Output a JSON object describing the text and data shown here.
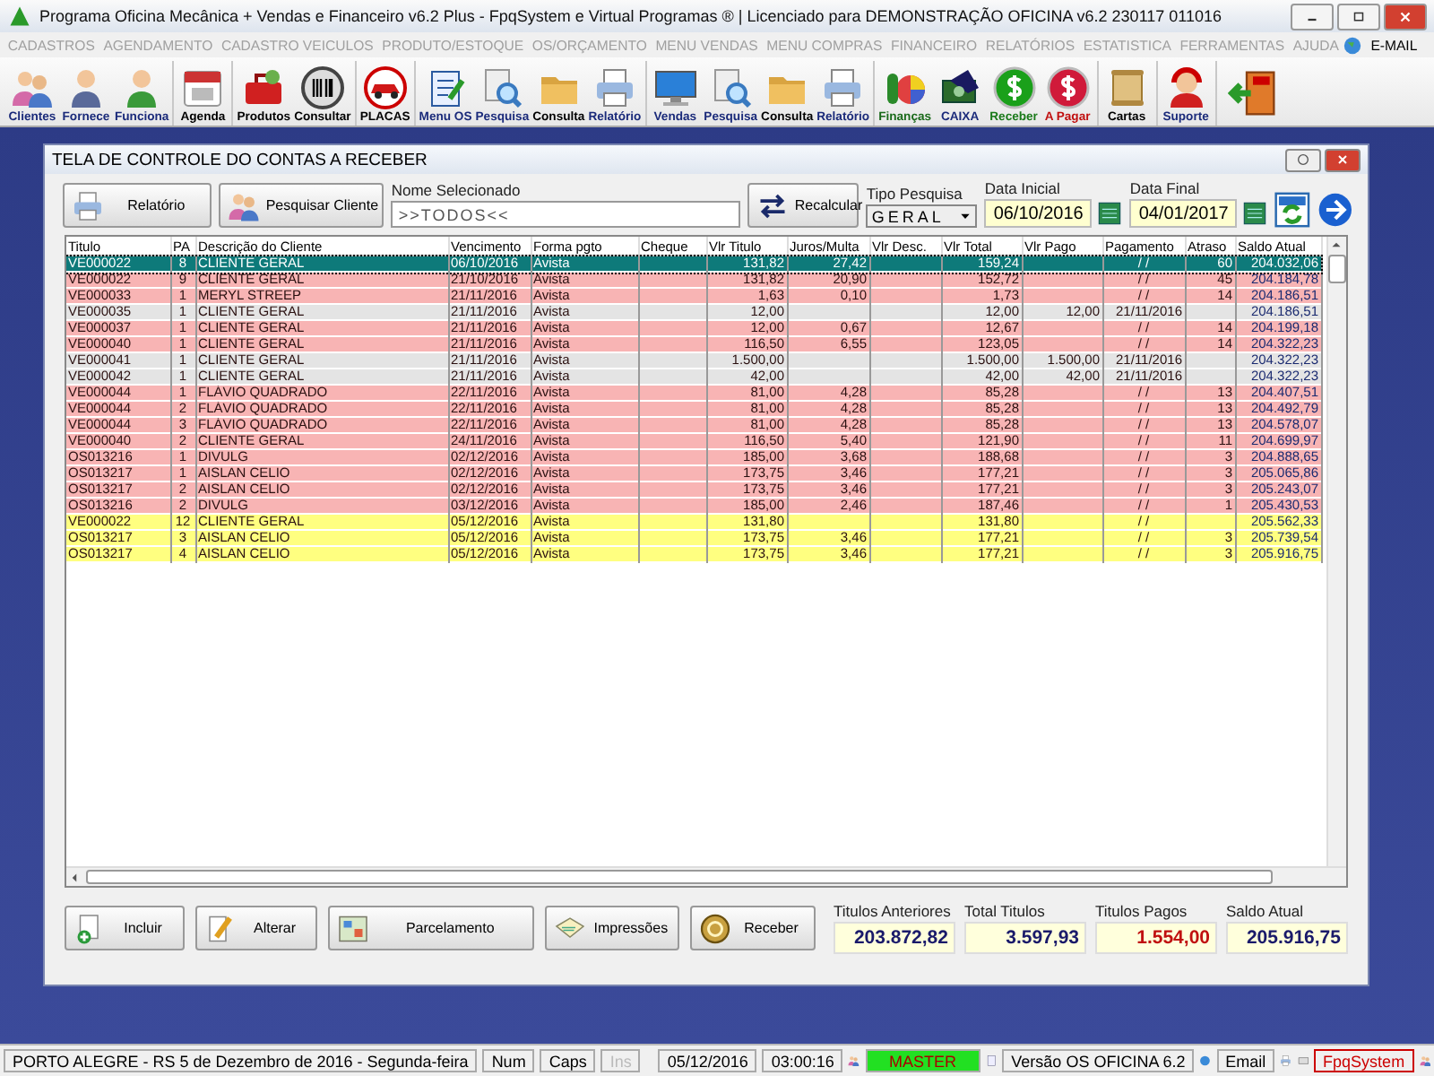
{
  "window": {
    "title": "Programa Oficina Mecânica + Vendas e Financeiro v6.2 Plus - FpqSystem e Virtual Programas ® | Licenciado para  DEMONSTRAÇÃO OFICINA v6.2 230117 011016"
  },
  "menu": [
    "CADASTROS",
    "AGENDAMENTO",
    "CADASTRO VEICULOS",
    "PRODUTO/ESTOQUE",
    "OS/ORÇAMENTO",
    "MENU VENDAS",
    "MENU COMPRAS",
    "FINANCEIRO",
    "RELATÓRIOS",
    "ESTATISTICA",
    "FERRAMENTAS",
    "AJUDA"
  ],
  "menu_email": "E-MAIL",
  "toolbar": [
    [
      {
        "label": "Clientes",
        "color": "#1a2a7a"
      },
      {
        "label": "Fornece",
        "color": "#1a2a7a"
      },
      {
        "label": "Funciona",
        "color": "#1a2a7a"
      }
    ],
    [
      {
        "label": "Agenda",
        "color": "#000000"
      }
    ],
    [
      {
        "label": "Produtos",
        "color": "#000000"
      },
      {
        "label": "Consultar",
        "color": "#000000"
      }
    ],
    [
      {
        "label": "PLACAS",
        "color": "#000000"
      }
    ],
    [
      {
        "label": "Menu OS",
        "color": "#1a2a7a"
      },
      {
        "label": "Pesquisa",
        "color": "#1a2a7a"
      },
      {
        "label": "Consulta",
        "color": "#000000"
      },
      {
        "label": "Relatório",
        "color": "#1a2a7a"
      }
    ],
    [
      {
        "label": "Vendas",
        "color": "#1a2a7a"
      },
      {
        "label": "Pesquisa",
        "color": "#1a2a7a"
      },
      {
        "label": "Consulta",
        "color": "#000000"
      },
      {
        "label": "Relatório",
        "color": "#1a2a7a"
      }
    ],
    [
      {
        "label": "Finanças",
        "color": "#1a6a1a"
      },
      {
        "label": "CAIXA",
        "color": "#1a2a7a"
      },
      {
        "label": "Receber",
        "color": "#1a7a1a"
      },
      {
        "label": "A Pagar",
        "color": "#c01010"
      }
    ],
    [
      {
        "label": "Cartas",
        "color": "#000000"
      }
    ],
    [
      {
        "label": "Suporte",
        "color": "#1a2a7a"
      }
    ]
  ],
  "dialog": {
    "title": "TELA DE CONTROLE DO CONTAS A RECEBER",
    "report_button": "Relatório",
    "search_client_button": "Pesquisar Cliente",
    "name_field": {
      "label": "Nome Selecionado",
      "value": ">>TODOS<<"
    },
    "recalc_button": "Recalcular",
    "search_type": {
      "label": "Tipo  Pesquisa",
      "value": "GERAL"
    },
    "start_date": {
      "label": "Data Inicial",
      "value": "06/10/2016"
    },
    "end_date": {
      "label": "Data Final",
      "value": "04/01/2017"
    },
    "table": {
      "columns": [
        "Titulo",
        "PA",
        "Descrição do Cliente",
        "Vencimento",
        "Forma pgto",
        "Cheque",
        "Vlr Titulo",
        "Juros/Multa",
        "Vlr Desc.",
        "Vlr Total",
        "Vlr Pago",
        "Pagamento",
        "Atraso",
        "Saldo Atual"
      ],
      "rows": [
        {
          "selected": true,
          "color": "#0e7a7a",
          "titulo": "VE000022",
          "pa": "8",
          "cliente": "CLIENTE GERAL",
          "vencimento": "06/10/2016",
          "forma": "Avista",
          "vlr_titulo": "131,82",
          "juros": "27,42",
          "vlr_total": "159,24",
          "pagamento": "/ /",
          "atraso": "60",
          "saldo": "204.032,06"
        },
        {
          "selected": false,
          "color": "#f8b4b4",
          "titulo": "VE000022",
          "pa": "9",
          "cliente": "CLIENTE GERAL",
          "vencimento": "21/10/2016",
          "forma": "Avista",
          "vlr_titulo": "131,82",
          "juros": "20,90",
          "vlr_total": "152,72",
          "pagamento": "/ /",
          "atraso": "45",
          "saldo": "204.184,78"
        },
        {
          "selected": false,
          "color": "#f8b4b4",
          "titulo": "VE000033",
          "pa": "1",
          "cliente": "MERYL STREEP",
          "vencimento": "21/11/2016",
          "forma": "Avista",
          "vlr_titulo": "1,63",
          "juros": "0,10",
          "vlr_total": "1,73",
          "pagamento": "/ /",
          "atraso": "14",
          "saldo": "204.186,51"
        },
        {
          "selected": false,
          "color": "#e4e4e4",
          "titulo": "VE000035",
          "pa": "1",
          "cliente": "CLIENTE GERAL",
          "vencimento": "21/11/2016",
          "forma": "Avista",
          "vlr_titulo": "12,00",
          "vlr_total": "12,00",
          "vlr_pago": "12,00",
          "pagamento": "21/11/2016",
          "saldo": "204.186,51"
        },
        {
          "selected": false,
          "color": "#f8b4b4",
          "titulo": "VE000037",
          "pa": "1",
          "cliente": "CLIENTE GERAL",
          "vencimento": "21/11/2016",
          "forma": "Avista",
          "vlr_titulo": "12,00",
          "juros": "0,67",
          "vlr_total": "12,67",
          "pagamento": "/ /",
          "atraso": "14",
          "saldo": "204.199,18"
        },
        {
          "selected": false,
          "color": "#f8b4b4",
          "titulo": "VE000040",
          "pa": "1",
          "cliente": "CLIENTE GERAL",
          "vencimento": "21/11/2016",
          "forma": "Avista",
          "vlr_titulo": "116,50",
          "juros": "6,55",
          "vlr_total": "123,05",
          "pagamento": "/ /",
          "atraso": "14",
          "saldo": "204.322,23"
        },
        {
          "selected": false,
          "color": "#e4e4e4",
          "titulo": "VE000041",
          "pa": "1",
          "cliente": "CLIENTE GERAL",
          "vencimento": "21/11/2016",
          "forma": "Avista",
          "vlr_titulo": "1.500,00",
          "vlr_total": "1.500,00",
          "vlr_pago": "1.500,00",
          "pagamento": "21/11/2016",
          "saldo": "204.322,23"
        },
        {
          "selected": false,
          "color": "#e4e4e4",
          "titulo": "VE000042",
          "pa": "1",
          "cliente": "CLIENTE GERAL",
          "vencimento": "21/11/2016",
          "forma": "Avista",
          "vlr_titulo": "42,00",
          "vlr_total": "42,00",
          "vlr_pago": "42,00",
          "pagamento": "21/11/2016",
          "saldo": "204.322,23"
        },
        {
          "selected": false,
          "color": "#f8b4b4",
          "titulo": "VE000044",
          "pa": "1",
          "cliente": "FLÁVIO QUADRADO",
          "vencimento": "22/11/2016",
          "forma": "Avista",
          "vlr_titulo": "81,00",
          "juros": "4,28",
          "vlr_total": "85,28",
          "pagamento": "/ /",
          "atraso": "13",
          "saldo": "204.407,51"
        },
        {
          "selected": false,
          "color": "#f8b4b4",
          "titulo": "VE000044",
          "pa": "2",
          "cliente": "FLÁVIO QUADRADO",
          "vencimento": "22/11/2016",
          "forma": "Avista",
          "vlr_titulo": "81,00",
          "juros": "4,28",
          "vlr_total": "85,28",
          "pagamento": "/ /",
          "atraso": "13",
          "saldo": "204.492,79"
        },
        {
          "selected": false,
          "color": "#f8b4b4",
          "titulo": "VE000044",
          "pa": "3",
          "cliente": "FLÁVIO QUADRADO",
          "vencimento": "22/11/2016",
          "forma": "Avista",
          "vlr_titulo": "81,00",
          "juros": "4,28",
          "vlr_total": "85,28",
          "pagamento": "/ /",
          "atraso": "13",
          "saldo": "204.578,07"
        },
        {
          "selected": false,
          "color": "#f8b4b4",
          "titulo": "VE000040",
          "pa": "2",
          "cliente": "CLIENTE GERAL",
          "vencimento": "24/11/2016",
          "forma": "Avista",
          "vlr_titulo": "116,50",
          "juros": "5,40",
          "vlr_total": "121,90",
          "pagamento": "/ /",
          "atraso": "11",
          "saldo": "204.699,97"
        },
        {
          "selected": false,
          "color": "#f8b4b4",
          "titulo": "OS013216",
          "pa": "1",
          "cliente": "DIVULG",
          "vencimento": "02/12/2016",
          "forma": "Avista",
          "vlr_titulo": "185,00",
          "juros": "3,68",
          "vlr_total": "188,68",
          "pagamento": "/ /",
          "atraso": "3",
          "saldo": "204.888,65"
        },
        {
          "selected": false,
          "color": "#f8b4b4",
          "titulo": "OS013217",
          "pa": "1",
          "cliente": "AISLAN CELIO",
          "vencimento": "02/12/2016",
          "forma": "Avista",
          "vlr_titulo": "173,75",
          "juros": "3,46",
          "vlr_total": "177,21",
          "pagamento": "/ /",
          "atraso": "3",
          "saldo": "205.065,86"
        },
        {
          "selected": false,
          "color": "#f8b4b4",
          "titulo": "OS013217",
          "pa": "2",
          "cliente": "AISLAN CELIO",
          "vencimento": "02/12/2016",
          "forma": "Avista",
          "vlr_titulo": "173,75",
          "juros": "3,46",
          "vlr_total": "177,21",
          "pagamento": "/ /",
          "atraso": "3",
          "saldo": "205.243,07"
        },
        {
          "selected": false,
          "color": "#f8b4b4",
          "titulo": "OS013216",
          "pa": "2",
          "cliente": "DIVULG",
          "vencimento": "03/12/2016",
          "forma": "Avista",
          "vlr_titulo": "185,00",
          "juros": "2,46",
          "vlr_total": "187,46",
          "pagamento": "/ /",
          "atraso": "1",
          "saldo": "205.430,53"
        },
        {
          "selected": false,
          "color": "#ffff80",
          "titulo": "VE000022",
          "pa": "12",
          "cliente": "CLIENTE GERAL",
          "vencimento": "05/12/2016",
          "forma": "Avista",
          "vlr_titulo": "131,80",
          "vlr_total": "131,80",
          "pagamento": "/ /",
          "saldo": "205.562,33"
        },
        {
          "selected": false,
          "color": "#ffff80",
          "titulo": "OS013217",
          "pa": "3",
          "cliente": "AISLAN CELIO",
          "vencimento": "05/12/2016",
          "forma": "Avista",
          "vlr_titulo": "173,75",
          "juros": "3,46",
          "vlr_total": "177,21",
          "pagamento": "/ /",
          "atraso": "3",
          "saldo": "205.739,54"
        },
        {
          "selected": false,
          "color": "#ffff80",
          "titulo": "OS013217",
          "pa": "4",
          "cliente": "AISLAN CELIO",
          "vencimento": "05/12/2016",
          "forma": "Avista",
          "vlr_titulo": "173,75",
          "juros": "3,46",
          "vlr_total": "177,21",
          "pagamento": "/ /",
          "atraso": "3",
          "saldo": "205.916,75"
        }
      ]
    },
    "actions": [
      "Incluir",
      "Alterar",
      "Parcelamento",
      "Impressões",
      "Receber"
    ],
    "totals": [
      {
        "label": "Titulos Anteriores",
        "value": "203.872,82",
        "kind": "normal"
      },
      {
        "label": "Total Titulos",
        "value": "3.597,93",
        "kind": "normal"
      },
      {
        "label": "Titulos Pagos",
        "value": "1.554,00",
        "kind": "paid"
      },
      {
        "label": "Saldo Atual",
        "value": "205.916,75",
        "kind": "normal"
      }
    ]
  },
  "status_bar": {
    "location": "PORTO ALEGRE - RS  5 de Dezembro de 2016 - Segunda-feira",
    "num": "Num",
    "caps": "Caps",
    "ins": {
      "label": "Ins",
      "on": false
    },
    "date": "05/12/2016",
    "time": "03:00:16",
    "user": "MASTER",
    "version": "Versão OS OFICINA 6.2",
    "email": "Email",
    "brand": "FpqSystem"
  }
}
